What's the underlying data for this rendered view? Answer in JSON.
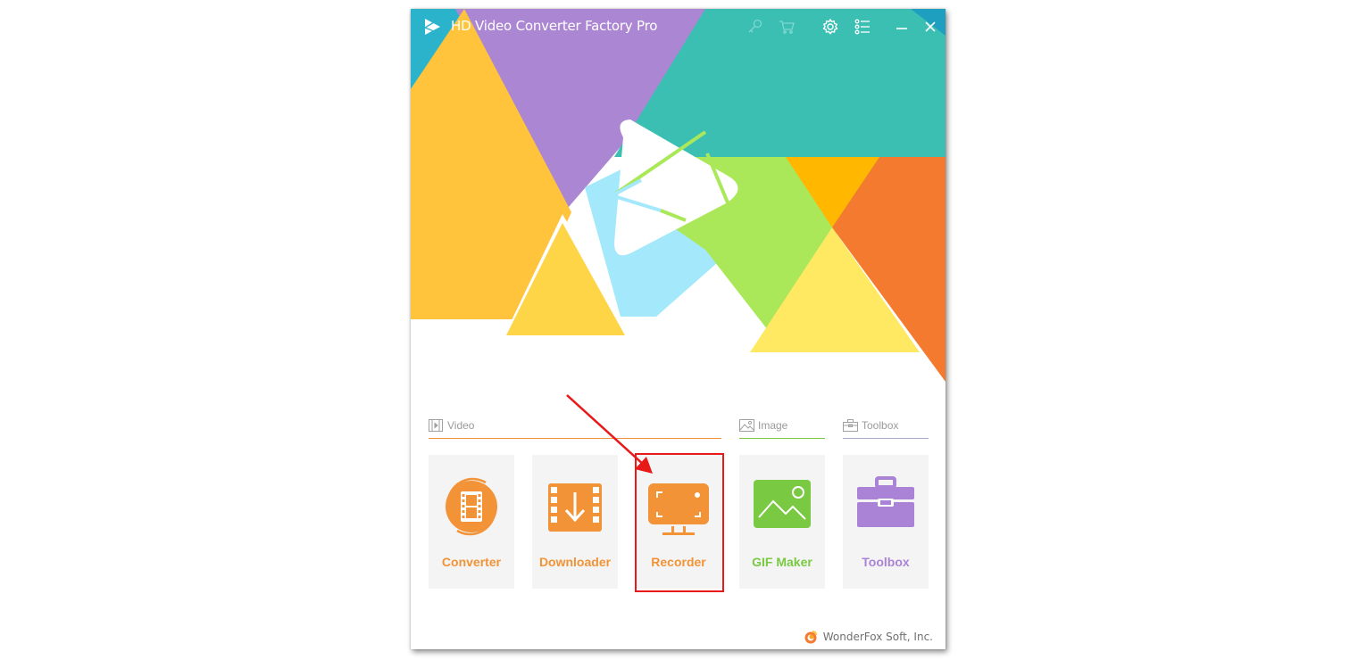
{
  "window": {
    "title": "HD Video Converter Factory Pro",
    "titlebar_buttons": [
      {
        "name": "register",
        "icon": "key-icon"
      },
      {
        "name": "buy",
        "icon": "cart-icon"
      },
      {
        "name": "settings",
        "icon": "gear-icon"
      },
      {
        "name": "menu",
        "icon": "list-icon"
      },
      {
        "name": "minimize",
        "icon": "minimize-icon"
      },
      {
        "name": "close",
        "icon": "close-icon"
      }
    ]
  },
  "sections": [
    {
      "label": "Video",
      "icon": "film-icon",
      "color": "#f29337"
    },
    {
      "label": "Image",
      "icon": "image-icon",
      "color": "#7ac943"
    },
    {
      "label": "Toolbox",
      "icon": "toolbox-icon",
      "color": "#a8a8c8"
    }
  ],
  "tiles": [
    {
      "label": "Converter",
      "icon": "converter-icon",
      "color": "#f29337"
    },
    {
      "label": "Downloader",
      "icon": "downloader-icon",
      "color": "#f29337"
    },
    {
      "label": "Recorder",
      "icon": "recorder-icon",
      "color": "#f29337",
      "highlighted": true
    },
    {
      "label": "GIF Maker",
      "icon": "gif-maker-icon",
      "color": "#7ac943"
    },
    {
      "label": "Toolbox",
      "icon": "toolbox-icon",
      "color": "#ab83d6"
    }
  ],
  "footer": {
    "company": "WonderFox Soft, Inc."
  },
  "colors": {
    "teal": "#3bbfb3",
    "purple": "#ab86d3",
    "yellow_orange": "#ffc43c",
    "orange": "#f47a30",
    "green": "#aae85a",
    "light_blue": "#a4e8fb",
    "yellow": "#ffe862",
    "accent_red": "#e81919"
  }
}
